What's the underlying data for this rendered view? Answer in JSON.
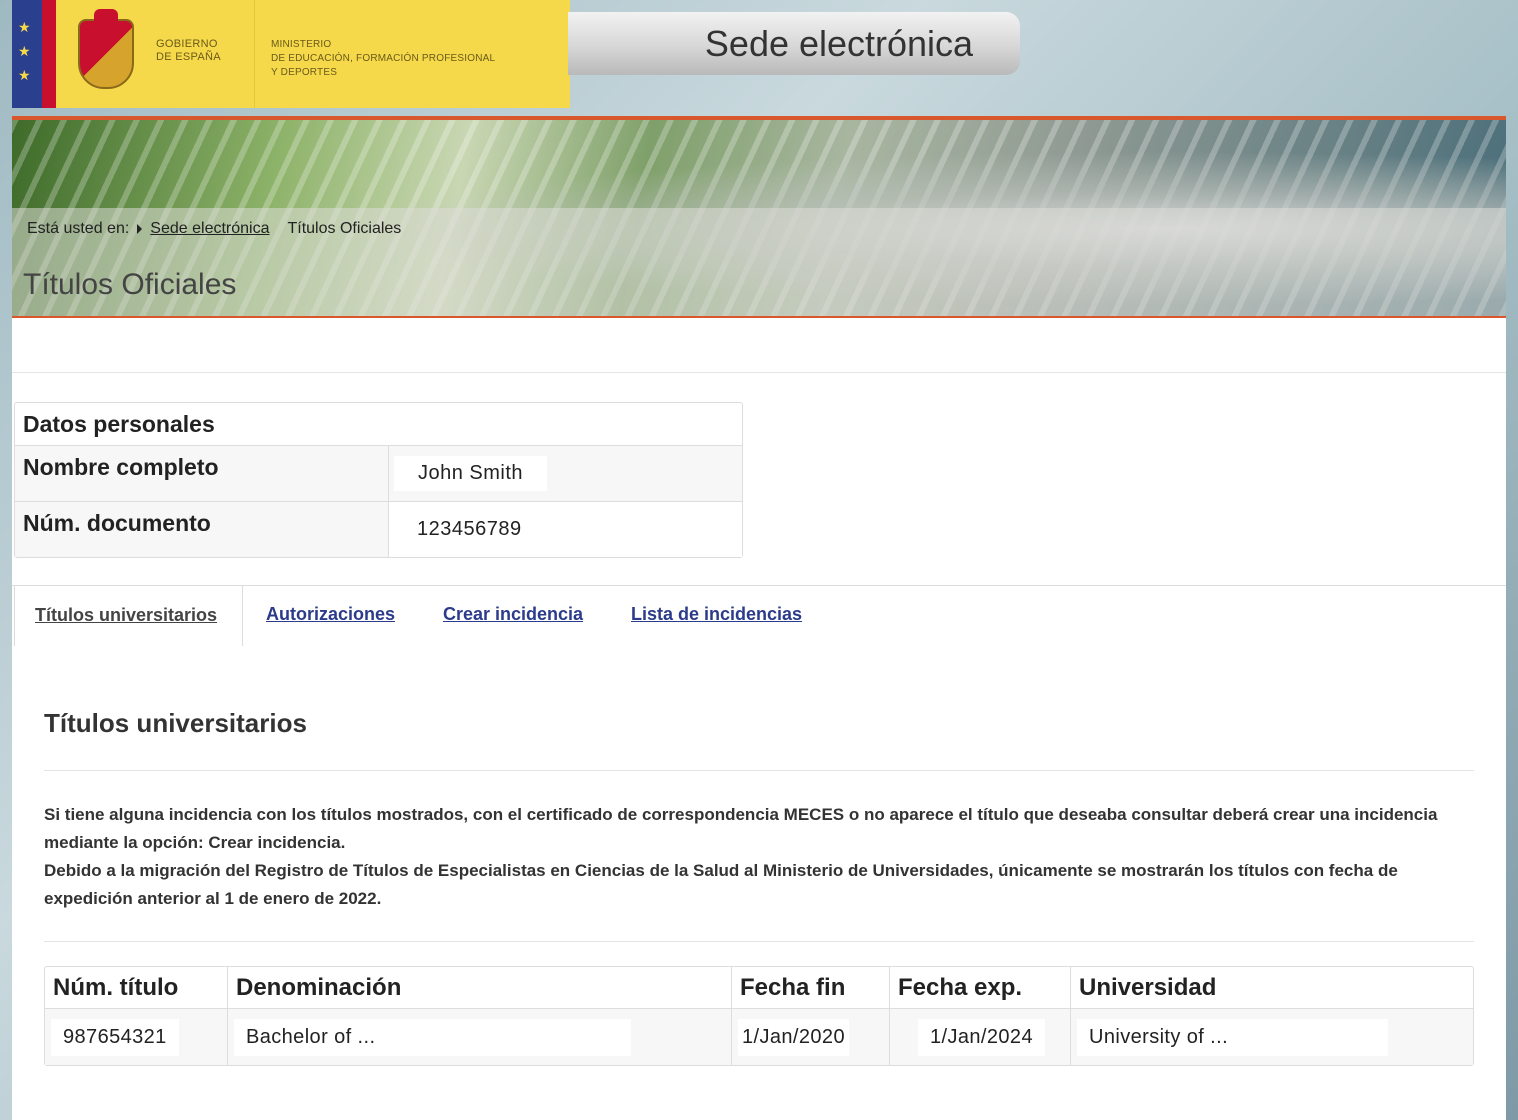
{
  "header": {
    "gov_line1": "GOBIERNO",
    "gov_line2": "DE ESPAÑA",
    "ministry_line1": "MINISTERIO",
    "ministry_line2": "DE EDUCACIÓN, FORMACIÓN PROFESIONAL",
    "ministry_line3": "Y DEPORTES",
    "sede_title": "Sede electrónica"
  },
  "breadcrumb": {
    "prefix": "Está usted en:",
    "link": "Sede electrónica",
    "current": "Títulos Oficiales"
  },
  "page_title": "Títulos Oficiales",
  "personal": {
    "heading": "Datos personales",
    "rows": [
      {
        "label": "Nombre completo",
        "value": "John Smith"
      },
      {
        "label": "Núm. documento",
        "value": "123456789"
      }
    ]
  },
  "tabs": [
    {
      "label": "Títulos universitarios",
      "active": true
    },
    {
      "label": "Autorizaciones",
      "active": false
    },
    {
      "label": "Crear incidencia",
      "active": false
    },
    {
      "label": "Lista de incidencias",
      "active": false
    }
  ],
  "section": {
    "title": "Títulos universitarios",
    "notice_1": "Si tiene alguna incidencia con los títulos mostrados, con el certificado de correspondencia MECES o no aparece el título que deseaba consultar deberá crear una incidencia mediante la opción: Crear incidencia.",
    "notice_2": "Debido a la migración del Registro de Títulos de Especialistas en Ciencias de la Salud al Ministerio de Universidades, únicamente se mostrarán los títulos con fecha de expedición anterior al 1 de enero de 2022."
  },
  "titles_table": {
    "headers": [
      "Núm. título",
      "Denominación",
      "Fecha fin",
      "Fecha exp.",
      "Universidad"
    ],
    "rows": [
      [
        "987654321",
        "Bachelor of ...",
        "1/Jan/2020",
        "1/Jan/2024",
        "University of ..."
      ]
    ]
  },
  "colors": {
    "accent_orange": "#d8572d",
    "gov_yellow": "#f5d94a",
    "link_blue": "#2c3b8a"
  }
}
